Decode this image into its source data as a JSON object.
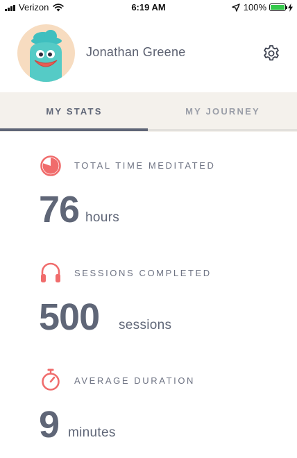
{
  "status_bar": {
    "carrier": "Verizon",
    "time": "6:19 AM",
    "battery": "100%",
    "battery_level": 1.0
  },
  "profile": {
    "name": "Jonathan Greene"
  },
  "tabs": [
    {
      "label": "MY STATS",
      "active": true
    },
    {
      "label": "MY JOURNEY",
      "active": false
    }
  ],
  "stats": [
    {
      "label": "TOTAL TIME MEDITATED",
      "value": "76",
      "unit": "hours",
      "icon": "pie-clock-icon"
    },
    {
      "label": "SESSIONS COMPLETED",
      "value": "500",
      "unit": "sessions",
      "icon": "headphones-icon"
    },
    {
      "label": "AVERAGE DURATION",
      "value": "9",
      "unit": "minutes",
      "icon": "stopwatch-icon"
    }
  ],
  "colors": {
    "accent": "#f06c6c",
    "text": "#5f6677",
    "tab_bar": "#f4f1ec",
    "avatar_bg": "#f7dcc0",
    "avatar_character": "#4ec8c4"
  }
}
